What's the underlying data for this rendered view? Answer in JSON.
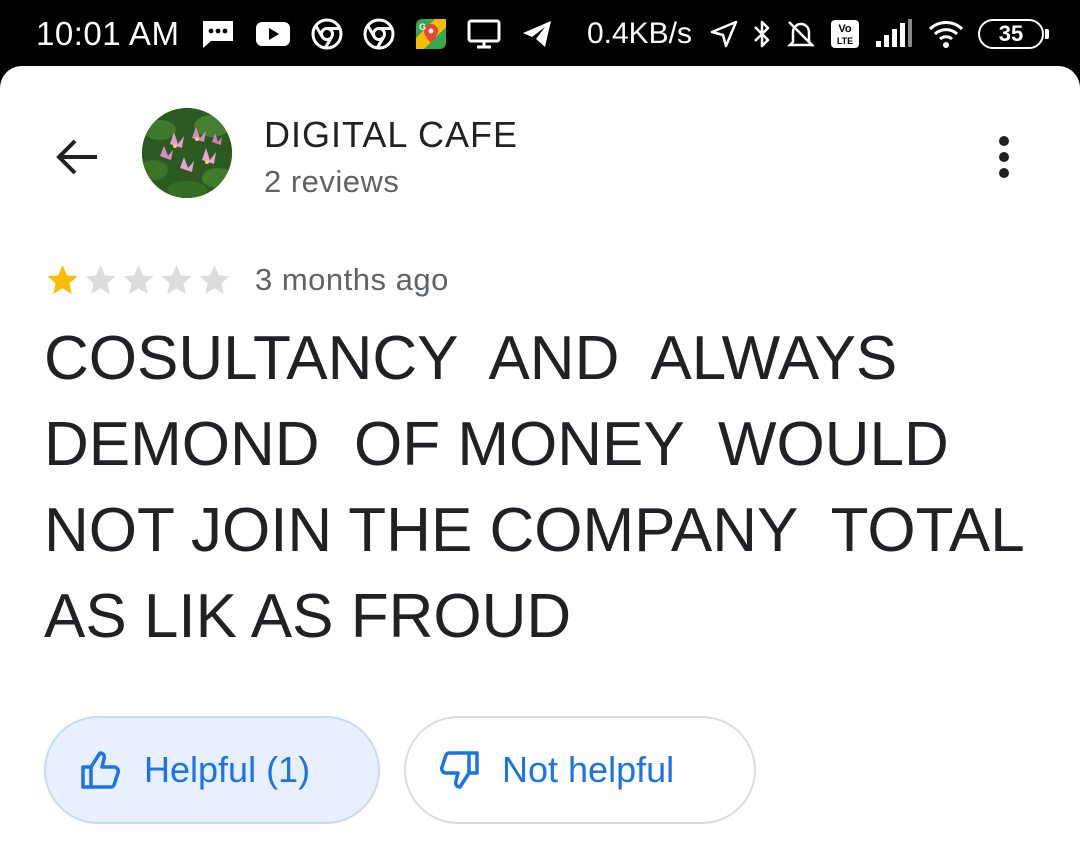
{
  "status_bar": {
    "time": "10:01 AM",
    "network_speed": "0.4KB/s",
    "battery_level": "35",
    "icons_left": [
      "chat-icon",
      "youtube-icon",
      "chrome-icon",
      "chrome-icon",
      "maps-icon",
      "monitor-icon",
      "telegram-icon"
    ],
    "icons_right": [
      "location-icon",
      "bluetooth-icon",
      "notifications-off-icon",
      "volte-icon",
      "signal-icon",
      "wifi-icon",
      "battery-icon"
    ]
  },
  "header": {
    "place_name": "DIGITAL CAFE",
    "review_count": "2 reviews",
    "avatar": "lotus-photo-avatar"
  },
  "review": {
    "rating": 1,
    "max_rating": 5,
    "date": "3 months ago",
    "text": "COSULTANCY  AND  ALWAYS\nDEMOND  OF MONEY  WOULD\nNOT JOIN THE COMPANY  TOTAL\nAS LIK AS FROUD"
  },
  "actions": {
    "helpful_label": "Helpful (1)",
    "not_helpful_label": "Not helpful"
  },
  "colors": {
    "accent": "#1a73e8",
    "star_filled": "#fbbc04",
    "star_empty": "#dadce0",
    "helpful_bg": "#e8f0fe"
  }
}
